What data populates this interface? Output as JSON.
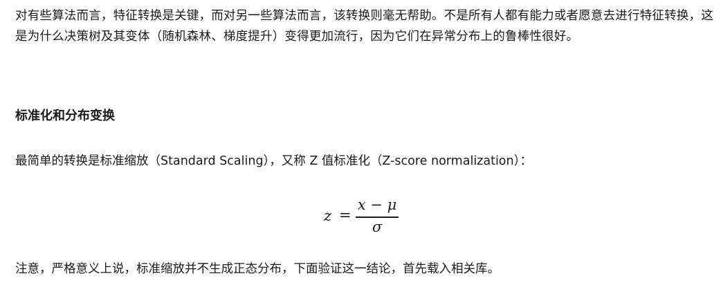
{
  "article": {
    "intro_paragraph": "对有些算法而言，特征转换是关键，而对另一些算法而言，该转换则毫无帮助。不是所有人都有能力或者愿意去进行特征转换，这是为什么决策树及其变体（随机森林、梯度提升）变得更加流行，因为它们在异常分布上的鲁棒性很好。",
    "section_heading": "标准化和分布变换",
    "scaling_paragraph": "最简单的转换是标准缩放（Standard Scaling），又称 Z 值标准化（Z-score normalization）：",
    "formula": {
      "lhs": "z",
      "equals": "=",
      "numerator": "x − μ",
      "denominator": "σ"
    },
    "note_paragraph": "注意，严格意义上说，标准缩放并不生成正态分布，下面验证这一结论，首先载入相关库。"
  }
}
